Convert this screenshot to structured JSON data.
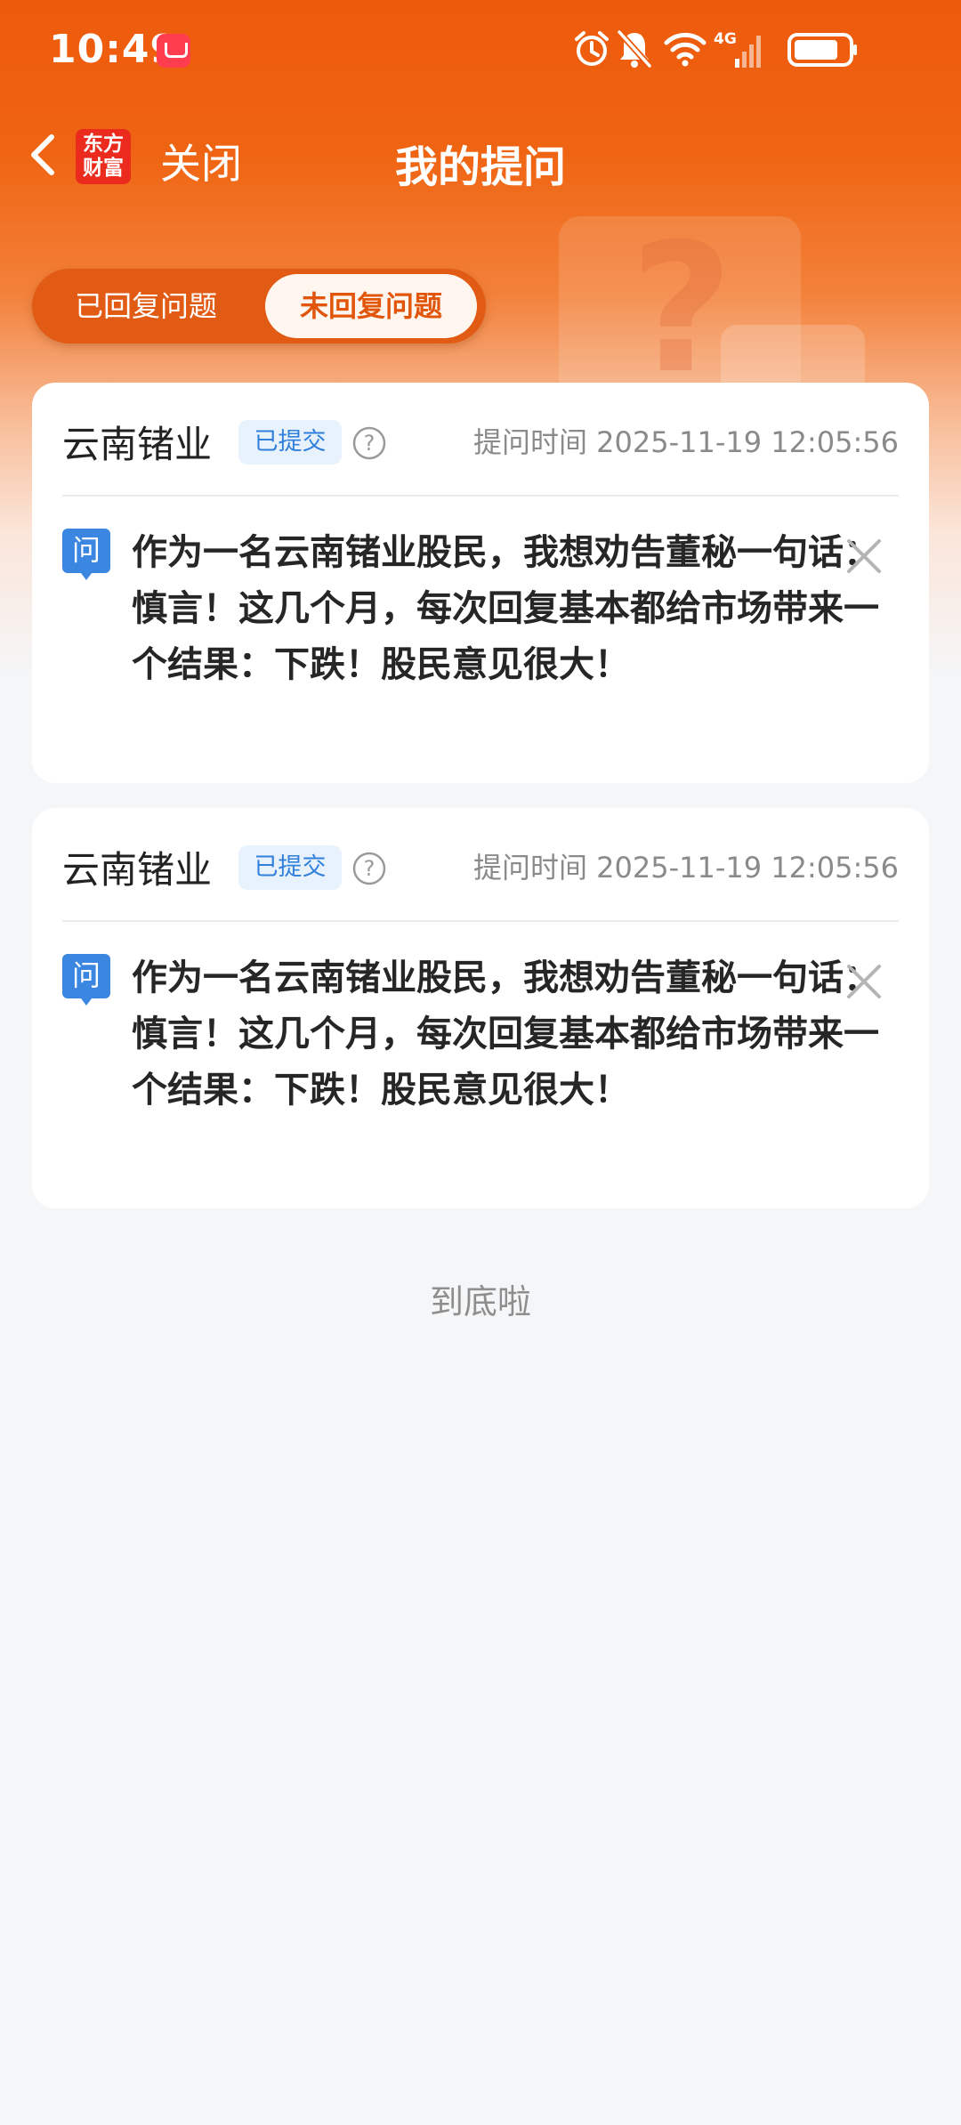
{
  "status_bar": {
    "time": "10:49",
    "app_icon": "huawei-store-icon",
    "icons": [
      "alarm-icon",
      "bell-muted-icon",
      "wifi-icon",
      "signal-4g-icon",
      "battery-icon"
    ],
    "network": "4G"
  },
  "header": {
    "back_icon": "chevron-left-icon",
    "logo_text_line1": "东方",
    "logo_text_line2": "财富",
    "close_label": "关闭",
    "title": "我的提问"
  },
  "tabs": [
    {
      "label": "已回复问题",
      "active": false
    },
    {
      "label": "未回复问题",
      "active": true
    }
  ],
  "questions": [
    {
      "company": "云南锗业",
      "status": "已提交",
      "time_label": "提问时间 2025-11-19 12:05:56",
      "icon_label": "问",
      "text": "作为一名云南锗业股民，我想劝告董秘一句话：慎言！这几个月，每次回复基本都给市场带来一个结果：下跌！股民意见很大！"
    },
    {
      "company": "云南锗业",
      "status": "已提交",
      "time_label": "提问时间 2025-11-19 12:05:56",
      "icon_label": "问",
      "text": "作为一名云南锗业股民，我想劝告董秘一句话：慎言！这几个月，每次回复基本都给市场带来一个结果：下跌！股民意见很大！"
    }
  ],
  "footer": {
    "end_text": "到底啦"
  },
  "colors": {
    "brand_orange": "#ee5a0c",
    "badge_blue": "#2f7fdb",
    "background": "#f5f6f8"
  }
}
